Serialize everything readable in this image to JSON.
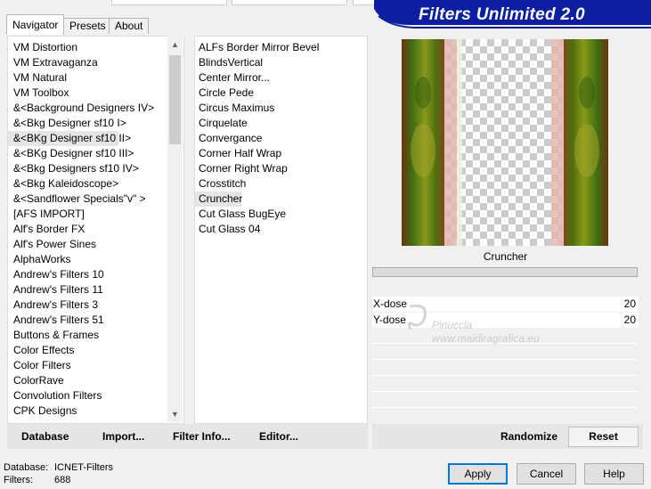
{
  "tabs": [
    {
      "label": "Navigator",
      "active": true
    },
    {
      "label": "Presets",
      "active": false
    },
    {
      "label": "About",
      "active": false
    }
  ],
  "banner": {
    "title": "Filters Unlimited 2.0",
    "color": "#0c1fa0"
  },
  "categories": {
    "selected_index": 6,
    "items": [
      "VM Distortion",
      "VM Extravaganza",
      "VM Natural",
      "VM Toolbox",
      "&<Background Designers IV>",
      "&<Bkg Designer sf10 I>",
      "&<BKg Designer sf10 II>",
      "&<BKg Designer sf10 III>",
      "&<Bkg Designers sf10 IV>",
      "&<Bkg Kaleidoscope>",
      "&<Sandflower Specials\"v\" >",
      "[AFS IMPORT]",
      "Alf's Border FX",
      "Alf's Power Sines",
      "AlphaWorks",
      "Andrew's Filters 10",
      "Andrew's Filters 11",
      "Andrew's Filters 3",
      "Andrew's Filters 51",
      "Buttons & Frames",
      "Color Effects",
      "Color Filters",
      "ColorRave",
      "Convolution Filters",
      "CPK Designs"
    ]
  },
  "filters": {
    "selected_index": 10,
    "items": [
      "ALFs Border Mirror Bevel",
      "BlindsVertical",
      "Center Mirror...",
      "Circle Pede",
      "Circus Maximus",
      "Cirquelate",
      "Convergance",
      "Corner Half Wrap",
      "Corner Right Wrap",
      "Crosstitch",
      "Cruncher",
      "Cut Glass  BugEye",
      "Cut Glass 04"
    ]
  },
  "settings": {
    "filter_name": "Cruncher",
    "params": [
      {
        "label": "X-dose",
        "value": "20"
      },
      {
        "label": "Y-dose",
        "value": "20"
      }
    ]
  },
  "actions": {
    "database": "Database",
    "import": "Import...",
    "filter_info": "Filter Info...",
    "editor": "Editor...",
    "randomize": "Randomize",
    "reset": "Reset"
  },
  "status": {
    "database_label": "Database:",
    "database_value": "ICNET-Filters",
    "filters_label": "Filters:",
    "filters_value": "688"
  },
  "dialog_buttons": {
    "apply": "Apply",
    "cancel": "Cancel",
    "help": "Help"
  },
  "watermark": {
    "line1": "Pinuccia",
    "line2": "www.maidiragrafica.eu"
  },
  "icons": {
    "scroll_up": "chevron-up-icon",
    "scroll_down": "chevron-down-icon"
  },
  "colors": {
    "accent": "#0078d7",
    "banner": "#0c1fa0",
    "preview_green": "#5a6e10",
    "preview_rose": "#e2b5ad"
  }
}
